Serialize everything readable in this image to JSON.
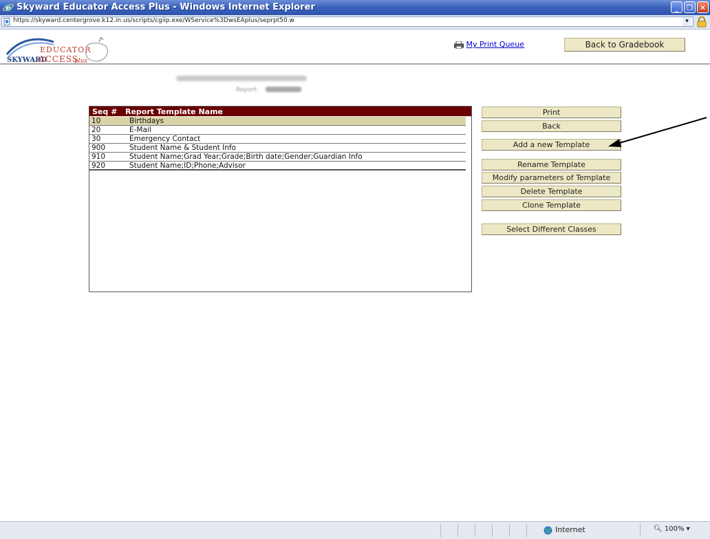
{
  "window": {
    "title": "Skyward Educator Access Plus - Windows Internet Explorer",
    "controls": [
      "minimize-icon",
      "restore-icon",
      "close-icon"
    ]
  },
  "address_bar": {
    "url": "https://skyward.centergrove.k12.in.us/scripts/cgiip.exe/WService%3DwsEAplus/seprpt50.w"
  },
  "header": {
    "logo_top": "EDUCATOR",
    "logo_bottom": "ACCESS",
    "logo_brand": "SKYWARD",
    "logo_plus": "plus",
    "print_queue_link": "My Print Queue",
    "back_to_gradebook": "Back to Gradebook",
    "report_label": "Report:"
  },
  "table": {
    "headers": {
      "seq": "Seq #",
      "name": "Report Template Name"
    },
    "rows": [
      {
        "seq": "10",
        "name": "Birthdays",
        "selected": true
      },
      {
        "seq": "20",
        "name": "E-Mail",
        "selected": false
      },
      {
        "seq": "30",
        "name": "Emergency Contact",
        "selected": false
      },
      {
        "seq": "900",
        "name": "Student Name & Student Info",
        "selected": false
      },
      {
        "seq": "910",
        "name": "Student Name;Grad Year;Grade;Birth date;Gender;Guardian Info",
        "selected": false
      },
      {
        "seq": "920",
        "name": "Student Name;ID;Phone;Advisor",
        "selected": false
      }
    ]
  },
  "actions": {
    "print": "Print",
    "back": "Back",
    "add_template": "Add a new Template",
    "rename_template": "Rename Template",
    "modify_parameters": "Modify parameters of Template",
    "delete_template": "Delete Template",
    "clone_template": "Clone Template",
    "select_classes": "Select Different Classes"
  },
  "status_bar": {
    "zone": "Internet",
    "zoom": "100%"
  },
  "colors": {
    "table_header": "#6a0000",
    "selected_row": "#d9d3a8",
    "button_face": "#ece7c4",
    "titlebar": "#3c63bd"
  }
}
